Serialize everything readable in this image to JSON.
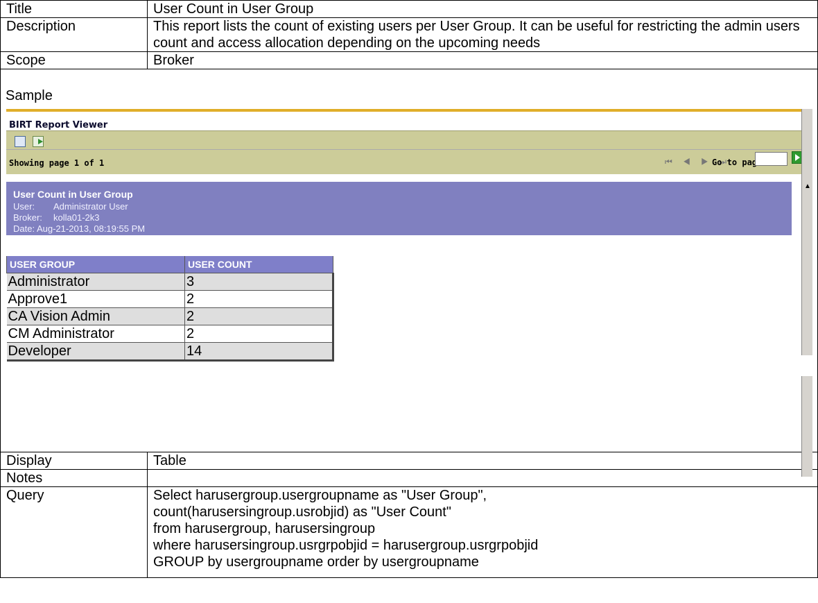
{
  "doc": {
    "title_label": "Title",
    "title_value": "User Count in User Group",
    "description_label": "Description",
    "description_value": "This report lists the count of existing users per User Group. It can be useful for restricting the admin users count and access allocation depending on the upcoming needs",
    "scope_label": "Scope",
    "scope_value": "Broker",
    "sample_label": "Sample",
    "display_label": "Display",
    "display_value": "Table",
    "notes_label": "Notes",
    "notes_value": "",
    "query_label": "Query",
    "query_lines": [
      "Select harusergroup.usergroupname as \"User Group\",",
      "count(harusersingroup.usrobjid) as \"User Count\"",
      "from harusergroup, harusersingroup",
      "where harusersingroup.usrgrpobjid  = harusergroup.usrgrpobjid",
      "GROUP by usergroupname order by usergroupname"
    ]
  },
  "birt": {
    "viewer_title": "BIRT Report Viewer",
    "showing": "Showing page  1  of  1",
    "nav_arrows": "⏮ ◀ ▶ ⏭",
    "goto_label": "Go to page:",
    "goto_value": "",
    "report_title": "User Count in User Group",
    "user_label": "User:",
    "user_value": "Administrator User",
    "broker_label": "Broker:",
    "broker_value": "kolla01-2k3",
    "date_text": "Date: Aug-21-2013, 08:19:55 PM",
    "columns": [
      "USER GROUP",
      "USER COUNT"
    ],
    "rows": [
      [
        "Administrator",
        "3"
      ],
      [
        "Approve1",
        "2"
      ],
      [
        "CA Vision Admin",
        "2"
      ],
      [
        "CM Administrator",
        "2"
      ],
      [
        "Developer",
        "14"
      ]
    ],
    "colors": {
      "accent_line": "#e0ae2a",
      "toolbar": "#cccc99",
      "header_band": "#8080c0"
    }
  }
}
